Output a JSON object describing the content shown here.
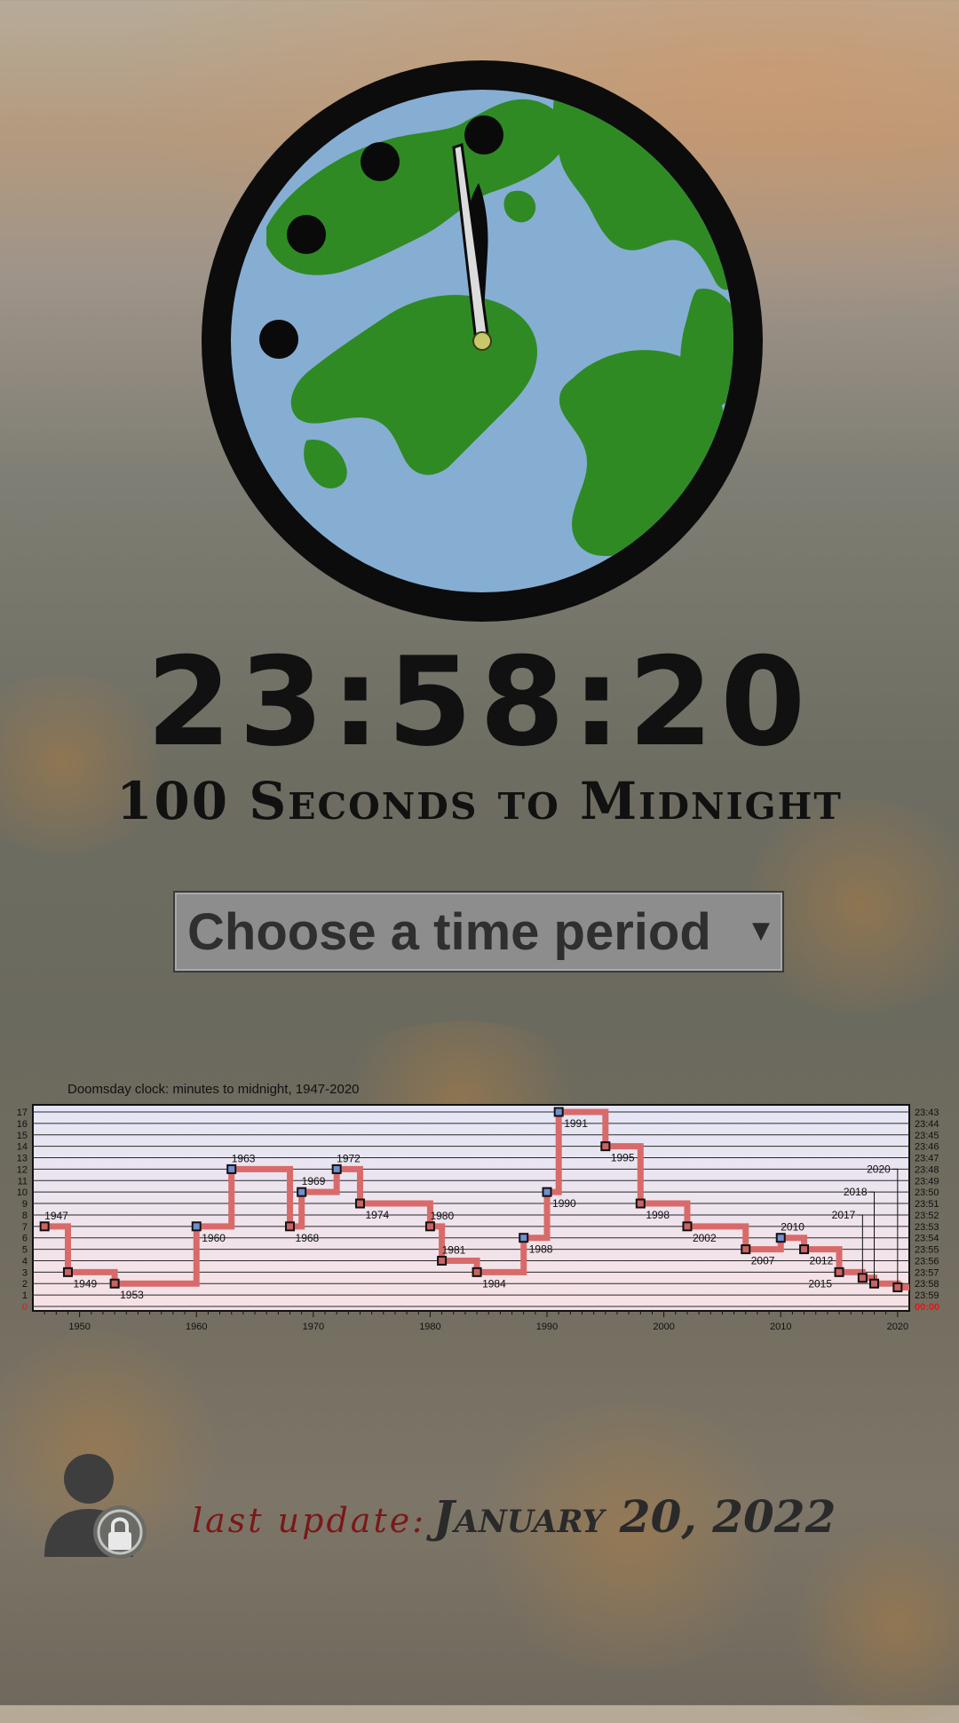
{
  "clock": {
    "time": "23:58:20",
    "caption": "100 Seconds to Midnight",
    "minute_hand_minutes": 58.33,
    "ocean_color": "#86aed3",
    "land_color": "#2f8a24",
    "rim_color": "#0c0c0c",
    "hand_color": "#dcdcdc",
    "center_color": "#c8c86a"
  },
  "period_select": {
    "selected": "Choose a time period"
  },
  "chart_data": {
    "type": "line",
    "title": "Doomsday clock: minutes to midnight, 1947-2020",
    "x_ticks": [
      "1950",
      "1960",
      "1970",
      "1980",
      "1990",
      "2000",
      "2010",
      "2020"
    ],
    "xlim": [
      1946,
      2021
    ],
    "y_left_ticks": [
      "0",
      "1",
      "2",
      "3",
      "4",
      "5",
      "6",
      "7",
      "8",
      "9",
      "10",
      "11",
      "12",
      "13",
      "14",
      "15",
      "16",
      "17"
    ],
    "y_right_ticks": [
      "00:00",
      "23:59",
      "23:58",
      "23:57",
      "23:56",
      "23:55",
      "23:54",
      "23:53",
      "23:52",
      "23:51",
      "23:50",
      "23:49",
      "23:48",
      "23:47",
      "23:46",
      "23:45",
      "23:44",
      "23:43"
    ],
    "ylim": [
      0,
      17
    ],
    "series": [
      {
        "points": [
          {
            "year": 1947,
            "label": "1947",
            "value": 7,
            "moved": "closer"
          },
          {
            "year": 1949,
            "label": "1949",
            "value": 3,
            "moved": "closer"
          },
          {
            "year": 1953,
            "label": "1953",
            "value": 2,
            "moved": "closer"
          },
          {
            "year": 1960,
            "label": "1960",
            "value": 7,
            "moved": "farther"
          },
          {
            "year": 1963,
            "label": "1963",
            "value": 12,
            "moved": "farther"
          },
          {
            "year": 1968,
            "label": "1968",
            "value": 7,
            "moved": "closer"
          },
          {
            "year": 1969,
            "label": "1969",
            "value": 10,
            "moved": "farther"
          },
          {
            "year": 1972,
            "label": "1972",
            "value": 12,
            "moved": "farther"
          },
          {
            "year": 1974,
            "label": "1974",
            "value": 9,
            "moved": "closer"
          },
          {
            "year": 1980,
            "label": "1980",
            "value": 7,
            "moved": "closer"
          },
          {
            "year": 1981,
            "label": "1981",
            "value": 4,
            "moved": "closer"
          },
          {
            "year": 1984,
            "label": "1984",
            "value": 3,
            "moved": "closer"
          },
          {
            "year": 1988,
            "label": "1988",
            "value": 6,
            "moved": "farther"
          },
          {
            "year": 1990,
            "label": "1990",
            "value": 10,
            "moved": "farther"
          },
          {
            "year": 1991,
            "label": "1991",
            "value": 17,
            "moved": "farther"
          },
          {
            "year": 1995,
            "label": "1995",
            "value": 14,
            "moved": "closer"
          },
          {
            "year": 1998,
            "label": "1998",
            "value": 9,
            "moved": "closer"
          },
          {
            "year": 2002,
            "label": "2002",
            "value": 7,
            "moved": "closer"
          },
          {
            "year": 2007,
            "label": "2007",
            "value": 5,
            "moved": "closer"
          },
          {
            "year": 2010,
            "label": "2010",
            "value": 6,
            "moved": "farther"
          },
          {
            "year": 2012,
            "label": "2012",
            "value": 5,
            "moved": "closer"
          },
          {
            "year": 2015,
            "label": "2015",
            "value": 3,
            "moved": "closer"
          },
          {
            "year": 2017,
            "label": "2017",
            "value": 2.5,
            "moved": "closer"
          },
          {
            "year": 2018,
            "label": "2018",
            "value": 2,
            "moved": "closer"
          },
          {
            "year": 2020,
            "label": "2020",
            "value": 1.67,
            "moved": "closer"
          }
        ]
      }
    ],
    "line_color": "#d96a6a",
    "closer_marker_color": "#c86464",
    "farther_marker_color": "#6f8fcf",
    "zero_label_color": "#e01818",
    "grid": true
  },
  "footer": {
    "last_update_label": "last update:",
    "last_update_value": "January 20, 2022",
    "icon": "user-lock-icon"
  }
}
